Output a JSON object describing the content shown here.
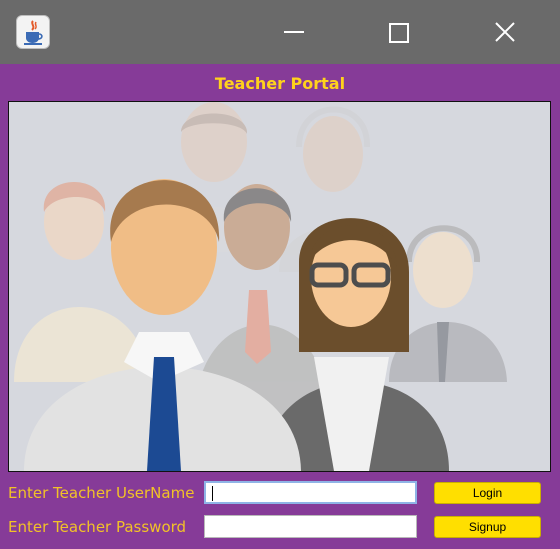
{
  "window": {
    "app_icon": "java-cup-icon",
    "controls": {
      "minimize": "minimize-icon",
      "maximize": "maximize-icon",
      "close": "close-icon"
    }
  },
  "portal": {
    "title": "Teacher Portal",
    "illustration": "people-group-illustration"
  },
  "form": {
    "username_label": "Enter Teacher UserName",
    "username_value": "",
    "password_label": "Enter Teacher Password",
    "password_value": "",
    "login_label": "Login",
    "signup_label": "Signup"
  },
  "colors": {
    "titlebar": "#6a6a6a",
    "background": "#863b98",
    "title_text": "#ffd21c",
    "label_text": "#f2c227",
    "button": "#ffdf00"
  }
}
